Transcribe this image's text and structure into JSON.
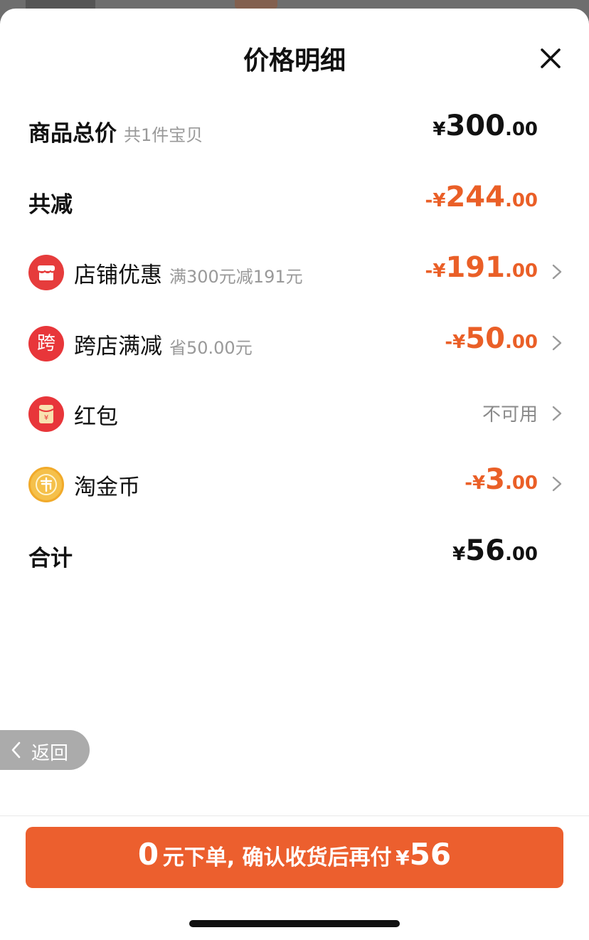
{
  "header": {
    "title": "价格明细"
  },
  "subtotal": {
    "label": "商品总价",
    "hint": "共1件宝贝",
    "currency": "¥",
    "integer": "300",
    "decimal": ".00"
  },
  "total_discount": {
    "label": "共减",
    "sign_currency": "-¥",
    "integer": "244",
    "decimal": ".00"
  },
  "discount_items": [
    {
      "label": "店铺优惠",
      "hint": "满300元减191元",
      "sign_currency": "-¥",
      "integer": "191",
      "decimal": ".00"
    },
    {
      "label": "跨店满减",
      "icon_text": "跨",
      "hint": "省50.00元",
      "sign_currency": "-¥",
      "integer": "50",
      "decimal": ".00"
    },
    {
      "label": "红包",
      "status": "不可用"
    },
    {
      "label": "淘金币",
      "sign_currency": "-¥",
      "integer": "3",
      "decimal": ".00"
    }
  ],
  "total": {
    "label": "合计",
    "currency": "¥",
    "integer": "56",
    "decimal": ".00"
  },
  "back_button": {
    "label": "返回"
  },
  "cta": {
    "zero": "0",
    "text": "元下单, 确认收货后再付",
    "currency": "¥",
    "amount": "56"
  },
  "colors": {
    "accent": "#ec5f2e",
    "discount_text": "#ea5f27",
    "icon_red": "#e8363a",
    "coin": "#f5c04a"
  },
  "icons": [
    "close-icon",
    "store-icon",
    "cross-store-icon",
    "red-packet-icon",
    "gold-coin-icon",
    "chevron-right-icon",
    "chevron-left-icon"
  ]
}
